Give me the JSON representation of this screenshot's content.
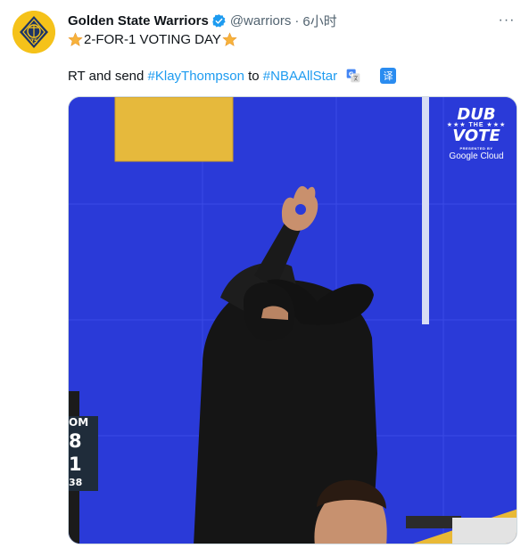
{
  "tweet": {
    "author_name": "Golden State Warriors",
    "handle": "@warriors",
    "separator": "·",
    "time": "6小时",
    "more_label": "···",
    "line1_text": "2-FOR-1 VOTING DAY",
    "line2_prefix": "RT and send ",
    "hashtag1": "#KlayThompson",
    "line2_middle": " to ",
    "hashtag2": "#NBAAllStar",
    "translate_label": "译"
  },
  "media": {
    "logo_line1": "DUB",
    "logo_line2": "★★★ THE ★★★",
    "logo_line3": "VOTE",
    "presented_by": "PRESENTED BY",
    "sponsor": "Google Cloud",
    "scoreboard_top": "OM",
    "scoreboard_a": "8",
    "scoreboard_b": "1",
    "scoreboard_bottom": "38"
  },
  "colors": {
    "link": "#1d9bf0",
    "verified": "#1d9bf0",
    "media_background": "#2a3ad8",
    "avatar_background": "#f5c21a"
  },
  "icons": {
    "verified": "verified-badge-icon",
    "star": "star-emoji-icon",
    "translate": "google-translate-icon",
    "more": "more-options-icon"
  }
}
